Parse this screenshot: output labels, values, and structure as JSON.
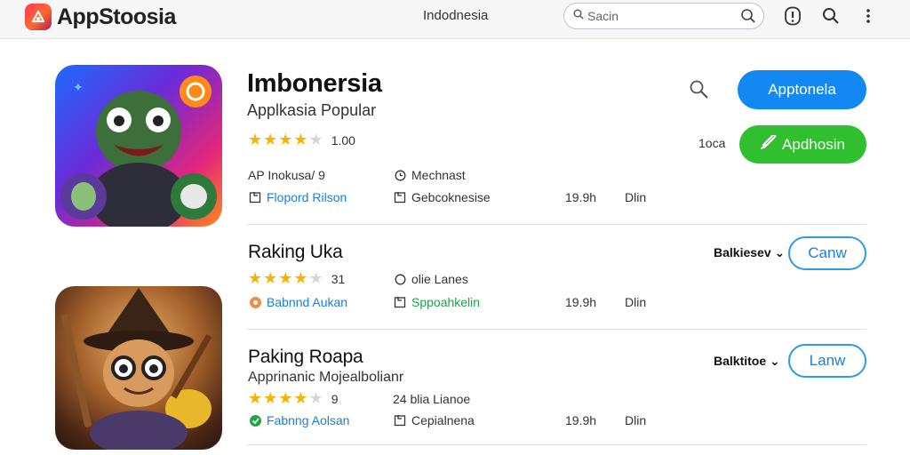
{
  "header": {
    "brand": "AppStoosia",
    "region": "Indodnesia",
    "search_placeholder": "Sacin"
  },
  "featured": {
    "title": "Imbonersia",
    "subtitle": "Applkasia Popular",
    "rating_text": "1.00",
    "rating": 4.5,
    "meta_left_1": "AP Inokusa/ 9",
    "meta_right_1": "Mechnast",
    "meta_left_2": "Flopord Rilson",
    "meta_right_2": "Gebcoknesise",
    "size": "19.9h",
    "meta_extra": "Dlin",
    "side_label": "1oca",
    "primary_button": "Apptonela",
    "secondary_button": "Apdhosin"
  },
  "list": [
    {
      "title": "Raking Uka",
      "subtitle": "",
      "rating_text": "31",
      "rating": 4.5,
      "info": "olie Lanes",
      "dev": "Babnnd Aukan",
      "category": "Sppoahkelin",
      "size": "19.9h",
      "extra": "Dlin",
      "side_label": "Balkiesev",
      "button": "Canw"
    },
    {
      "title": "Paking Roapa",
      "subtitle": "Apprinanic Mojealbolianr",
      "rating_text": "9",
      "rating": 4.5,
      "info": "24 blia Lianoe",
      "dev": "Fabnng Aolsan",
      "category": "Cepialnena",
      "size": "19.9h",
      "extra": "Dlin",
      "side_label": "Balktitoe",
      "button": "Lanw"
    }
  ],
  "colors": {
    "primary": "#1289f2",
    "green": "#2fbf2f",
    "star": "#f5b400",
    "outline": "#2d9be8"
  }
}
